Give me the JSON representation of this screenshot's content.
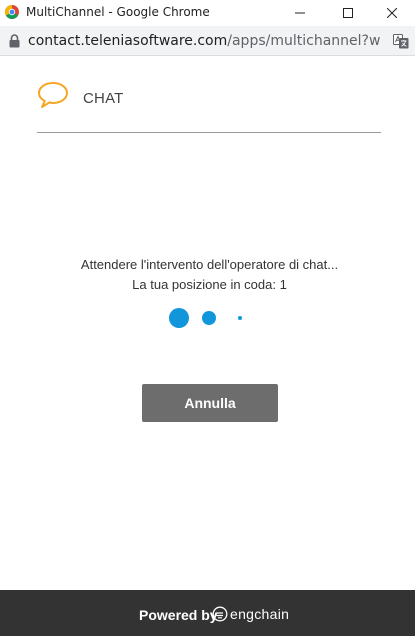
{
  "window": {
    "title": "MultiChannel - Google Chrome",
    "url_host": "contact.teleniasoftware.com",
    "url_path": "/apps/multichannel?widge..."
  },
  "icons": {
    "app": "chrome-logo-icon",
    "minimize": "minimize-icon",
    "maximize": "maximize-icon",
    "close": "close-icon",
    "lock": "lock-icon",
    "translate": "translate-icon",
    "chat": "chat-bubble-icon",
    "brand": "engchain-logo-icon"
  },
  "colors": {
    "accent_chat_icon": "#f5a623",
    "loading_dots": "#1296db",
    "cancel_button_bg": "#6d6d6d",
    "footer_bg": "#333333"
  },
  "header": {
    "title": "CHAT"
  },
  "status": {
    "line1": "Attendere l'intervento dell'operatore di chat...",
    "line2": "La tua posizione in coda: 1"
  },
  "actions": {
    "cancel_label": "Annulla"
  },
  "footer": {
    "powered_by": "Powered by",
    "brand": "engchain"
  }
}
